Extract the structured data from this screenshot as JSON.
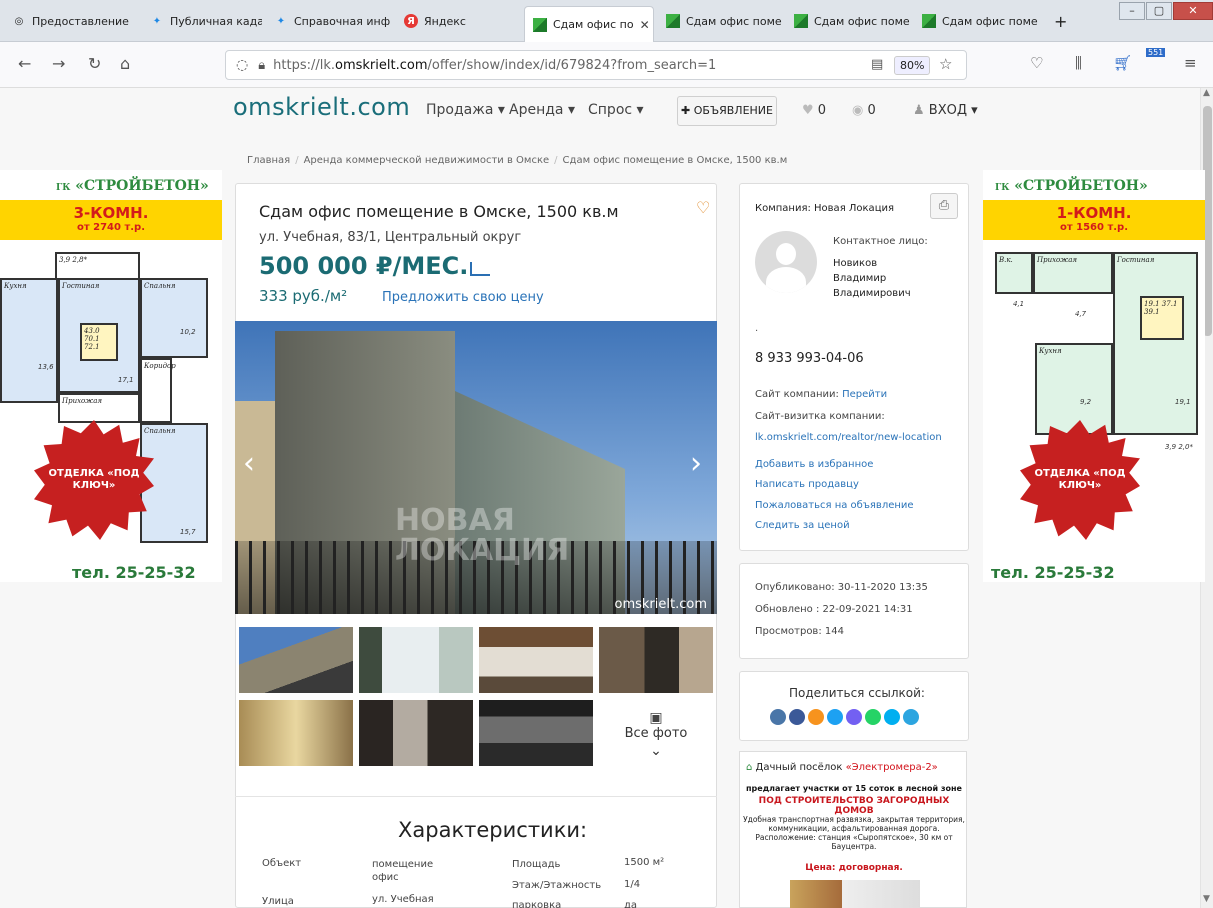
{
  "browser": {
    "tabs": [
      {
        "label": "Предоставление"
      },
      {
        "label": "Публичная кадас"
      },
      {
        "label": "Справочная инф"
      },
      {
        "label": "Яндекс"
      },
      {
        "label": "Сдам офис по"
      },
      {
        "label": "Сдам офис поме"
      },
      {
        "label": "Сдам офис поме"
      },
      {
        "label": "Сдам офис поме"
      }
    ],
    "new_tab": "+",
    "url_prefix": "https://lk.",
    "url_domain": "omskrielt.com",
    "url_path": "/offer/show/index/id/679824?from_search=1",
    "zoom": "80%",
    "badge": "551"
  },
  "site": {
    "logo": "omskrielt.com",
    "menu": [
      "Продажа ▾",
      "Аренда ▾",
      "Спрос ▾"
    ],
    "ad_button": "✚ ОБЪЯВЛЕНИЕ",
    "favorites_count": "0",
    "views_count": "0",
    "login": "ВХОД ▾"
  },
  "breadcrumbs": [
    "Главная",
    "Аренда коммерческой недвижимости в Омске",
    "Сдам офис помещение в Омске, 1500 кв.м"
  ],
  "listing": {
    "title": "Сдам офис помещение в Омске, 1500 кв.м",
    "address": "ул. Учебная, 83/1, Центральный округ",
    "price": "500 000 ₽/МЕС.",
    "price_per_m2": "333 руб./м²",
    "offer_price": "Предложить свою цену",
    "photo_caption": "omskrielt.com",
    "watermark_line1": "НОВАЯ",
    "watermark_line2": "ЛОКАЦИЯ",
    "all_photos": "Все фото"
  },
  "characteristics": {
    "title": "Характеристики:",
    "left": [
      {
        "label": "Объект",
        "value": "помещение офис"
      },
      {
        "label": "Улица",
        "value": "ул. Учебная"
      }
    ],
    "right": [
      {
        "label": "Площадь",
        "value": "1500 м²"
      },
      {
        "label": "Этаж/Этажность",
        "value": "1/4"
      },
      {
        "label": "парковка",
        "value": "да"
      }
    ]
  },
  "seller": {
    "company": "Компания: Новая Локация",
    "contact_label": "Контактное лицо:",
    "contact_name": "Новиков Владимир Владимирович",
    "dot": ".",
    "phone": "8 933 993-04-06",
    "site_label": "Сайт компании:",
    "site_link": "Перейти",
    "card_label": "Сайт-визитка компании:",
    "card_link": "lk.omskrielt.com/realtor/new-location",
    "actions": [
      "Добавить в избранное",
      "Написать продавцу",
      "Пожаловаться на объявление",
      "Следить за ценой"
    ]
  },
  "stats": {
    "published": "Опубликовано: 30-11-2020 13:35",
    "updated": "Обновлено : 22-09-2021 14:31",
    "views": "Просмотров: 144"
  },
  "share": {
    "label": "Поделиться ссылкой:",
    "colors": [
      "#4a76a8",
      "#3b5998",
      "#f7931e",
      "#1da1f2",
      "#7360f2",
      "#25d366",
      "#00aff0",
      "#2ca5e0"
    ]
  },
  "ad": {
    "line1_a": "Дачный посёлок",
    "line1_b": "«Электромера-2»",
    "line2": "предлагает участки от 15 соток в лесной зоне",
    "line3": "ПОД СТРОИТЕЛЬСТВО ЗАГОРОДНЫХ ДОМОВ",
    "line4": "Удобная транспортная развязка, закрытая территория, коммуникации, асфальтированная дорога. Расположение: станция «Сыропятское», 30 км от Бауцентра.",
    "line5": "Цена: договорная."
  },
  "banner_left": {
    "brand_small": "ГК",
    "brand": "«СТРОЙБЕТОН»",
    "title": "3-КОМН.",
    "price": "от 2740 т.р.",
    "badge": "ОТДЕЛКА «ПОД КЛЮЧ»",
    "phone": "тел. 25-25-32",
    "rooms": [
      "Кухня",
      "Гостиная",
      "Спальня",
      "Прихожая",
      "Коридор",
      "Спальня",
      "43.0 70.1 72.1",
      "13,6",
      "17,1",
      "10,2",
      "15,7",
      "3,9 2,8*"
    ]
  },
  "banner_right": {
    "brand_small": "ГК",
    "brand": "«СТРОЙБЕТОН»",
    "title": "1-КОМН.",
    "price": "от 1560 т.р.",
    "badge": "ОТДЕЛКА «ПОД КЛЮЧ»",
    "phone": "тел. 25-25-32",
    "rooms": [
      "Прихожая",
      "В.к.",
      "Кухня",
      "Гостиная",
      "19.1 37.1 39.1",
      "4,1",
      "4,7",
      "9,2",
      "19,1",
      "3,9 2,0*"
    ]
  }
}
